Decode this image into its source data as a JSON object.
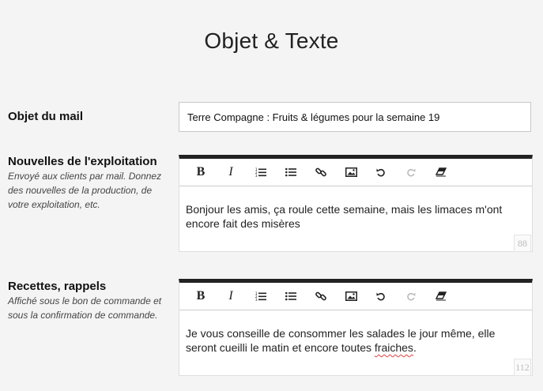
{
  "page": {
    "title": "Objet & Texte"
  },
  "subject": {
    "label": "Objet du mail",
    "value": "Terre Compagne : Fruits & légumes pour la semaine 19"
  },
  "toolbar_icons": [
    "bold-icon",
    "italic-icon",
    "ordered-list-icon",
    "bullet-list-icon",
    "link-icon",
    "image-icon",
    "undo-icon",
    "redo-icon",
    "eraser-icon"
  ],
  "news": {
    "label": "Nouvelles de l'exploitation",
    "help": "Envoyé aux clients par mail. Donnez des nouvelles de la production, de votre exploitation, etc.",
    "text": "Bonjour les amis, ça roule cette semaine, mais les limaces m'ont encore fait des misères",
    "counter": "88"
  },
  "recipes": {
    "label": "Recettes, rappels",
    "help": "Affiché sous le bon de commande et sous la confirmation de commande.",
    "text_before": "Je vous conseille de consommer les salades le jour même, elle seront cueilli le matin et encore toutes ",
    "text_misspelled": "fraiches",
    "text_after": ".",
    "counter": "112"
  },
  "toolbar": {
    "bold": "B",
    "italic": "I"
  },
  "colors": {
    "accent_bar": "#222222",
    "spellcheck": "#e04040"
  }
}
